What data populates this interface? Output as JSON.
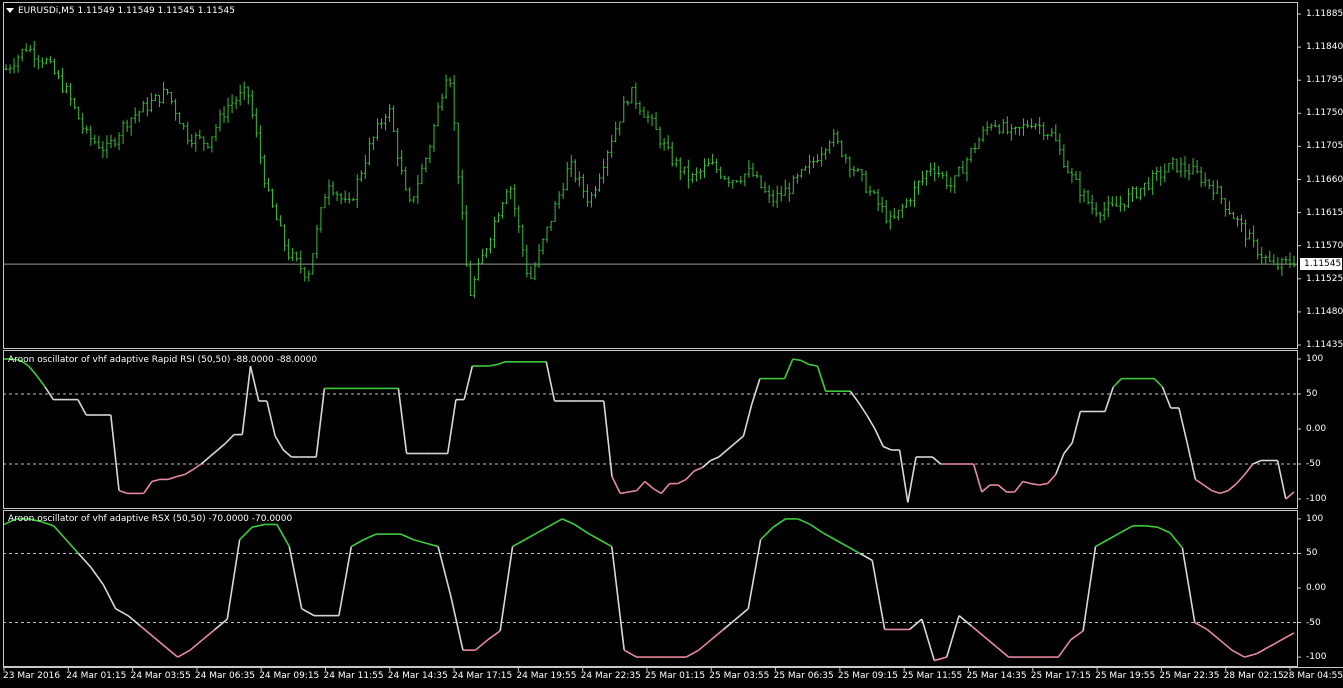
{
  "main_title": "EURUSDi,M5  1.11549 1.11549 1.11545 1.11545",
  "price_axis": [
    "1.11885",
    "1.11840",
    "1.11795",
    "1.11750",
    "1.11705",
    "1.11660",
    "1.11615",
    "1.11570",
    "1.11525",
    "1.11480",
    "1.11435"
  ],
  "current_price": "1.11545",
  "rsi_title": "Aroon oscillator of vhf adaptive Rapid RSI (50,50) -88.0000 -88.0000",
  "rsx_title": "Aroon oscillator of vhf adaptive RSX (50,50) -70.0000 -70.0000",
  "osc_axis": [
    "100",
    "50",
    "0.00",
    "-50",
    "-100"
  ],
  "time_axis": [
    "23 Mar 2016",
    "24 Mar 01:15",
    "24 Mar 03:55",
    "24 Mar 06:35",
    "24 Mar 09:15",
    "24 Mar 11:55",
    "24 Mar 14:35",
    "24 Mar 17:15",
    "24 Mar 19:55",
    "24 Mar 22:35",
    "25 Mar 01:15",
    "25 Mar 03:55",
    "25 Mar 06:35",
    "25 Mar 09:15",
    "25 Mar 11:55",
    "25 Mar 14:35",
    "25 Mar 17:15",
    "25 Mar 19:55",
    "25 Mar 22:35",
    "28 Mar 02:15",
    "28 Mar 04:55"
  ],
  "colors": {
    "price": "#3dbb3d",
    "up": "#3dcc3d",
    "flat": "#d8d8d8",
    "down": "#e88aa0",
    "grid": "#c0c0c0"
  },
  "chart_data": [
    {
      "type": "line",
      "title": "EURUSDi,M5",
      "ylim": [
        1.11435,
        1.11885
      ],
      "series": [
        {
          "values": [
            1.1181,
            1.1184,
            1.1182,
            1.1178,
            1.1172,
            1.117,
            1.1174,
            1.1176,
            1.1178,
            1.1172,
            1.1171,
            1.1176,
            1.1178,
            1.1164,
            1.1156,
            1.1153,
            1.1166,
            1.1162,
            1.117,
            1.1176,
            1.1162,
            1.117,
            1.1182,
            1.115,
            1.1158,
            1.1166,
            1.1152,
            1.116,
            1.1168,
            1.1163,
            1.1171,
            1.1178,
            1.1174,
            1.1169,
            1.1166,
            1.1168,
            1.1166,
            1.1167,
            1.1163,
            1.1165,
            1.1168,
            1.1172,
            1.1168,
            1.1164,
            1.116,
            1.1164,
            1.1168,
            1.1165,
            1.117,
            1.1174,
            1.1172,
            1.1174,
            1.1172,
            1.1166,
            1.1162,
            1.1162,
            1.1164,
            1.1166,
            1.1168,
            1.1167,
            1.1165,
            1.1161,
            1.1157,
            1.1154,
            1.1155
          ]
        }
      ],
      "current_price": 1.11545
    },
    {
      "type": "line",
      "title": "Aroon oscillator of vhf adaptive Rapid RSI (50,50)",
      "ylim": [
        -110,
        110
      ],
      "series": [
        {
          "values": [
            100,
            100,
            98,
            90,
            76,
            60,
            42,
            42,
            42,
            42,
            20,
            20,
            20,
            20,
            -88,
            -92,
            -92,
            -92,
            -75,
            -72,
            -72,
            -68,
            -65,
            -58,
            -50,
            -40,
            -30,
            -20,
            -8,
            -8,
            90,
            40,
            40,
            -10,
            -30,
            -40,
            -40,
            -40,
            -40,
            58,
            58,
            58,
            58,
            58,
            58,
            58,
            58,
            58,
            58,
            -35,
            -35,
            -35,
            -35,
            -35,
            -35,
            42,
            42,
            90,
            90,
            90,
            92,
            96,
            96,
            96,
            96,
            96,
            96,
            40,
            40,
            40,
            40,
            40,
            40,
            40,
            -68,
            -92,
            -90,
            -88,
            -75,
            -85,
            -92,
            -78,
            -78,
            -72,
            -60,
            -55,
            -45,
            -40,
            -30,
            -20,
            -10,
            35,
            72,
            72,
            72,
            72,
            100,
            98,
            92,
            90,
            54,
            54,
            54,
            54,
            38,
            20,
            0,
            -25,
            -30,
            -30,
            -105,
            -40,
            -40,
            -40,
            -50,
            -50,
            -50,
            -50,
            -50,
            -90,
            -80,
            -80,
            -90,
            -90,
            -75,
            -78,
            -80,
            -78,
            -65,
            -35,
            -20,
            25,
            25,
            25,
            25,
            60,
            72,
            72,
            72,
            72,
            72,
            60,
            30,
            30,
            -20,
            -72,
            -80,
            -88,
            -92,
            -88,
            -78,
            -65,
            -50,
            -45,
            -45,
            -45,
            -100,
            -90
          ]
        }
      ]
    },
    {
      "type": "line",
      "title": "Aroon oscillator of vhf adaptive RSX (50,50)",
      "ylim": [
        -110,
        110
      ],
      "series": [
        {
          "values": [
            92,
            100,
            100,
            96,
            90,
            70,
            50,
            30,
            5,
            -30,
            -40,
            -55,
            -70,
            -85,
            -100,
            -90,
            -75,
            -60,
            -45,
            70,
            88,
            92,
            92,
            60,
            -30,
            -40,
            -40,
            -40,
            60,
            70,
            78,
            78,
            78,
            70,
            65,
            60,
            -10,
            -90,
            -90,
            -75,
            -62,
            60,
            70,
            80,
            90,
            100,
            92,
            80,
            70,
            60,
            -90,
            -100,
            -100,
            -100,
            -100,
            -100,
            -90,
            -75,
            -60,
            -45,
            -30,
            70,
            88,
            100,
            100,
            92,
            80,
            70,
            60,
            50,
            40,
            -60,
            -60,
            -60,
            -45,
            -105,
            -100,
            -40,
            -55,
            -70,
            -85,
            -100,
            -100,
            -100,
            -100,
            -100,
            -75,
            -62,
            60,
            70,
            80,
            90,
            90,
            88,
            80,
            58,
            -50,
            -60,
            -75,
            -90,
            -100,
            -95,
            -85,
            -75,
            -65
          ]
        }
      ]
    }
  ]
}
